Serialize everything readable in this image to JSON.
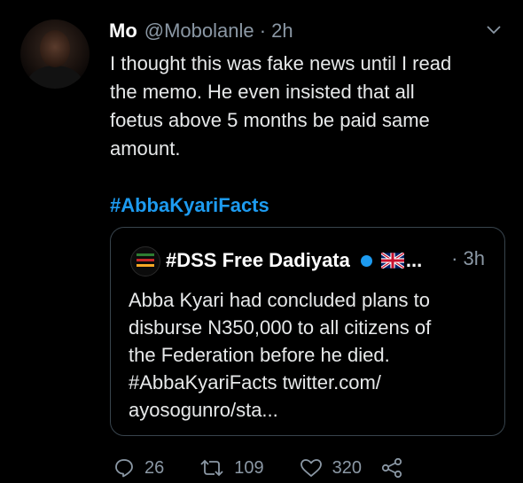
{
  "tweet": {
    "author_name": "Mo",
    "author_handle": "@Mobolanle · 2h",
    "text_lines": [
      "I thought this was fake news until I read",
      "the memo. He even insisted that all",
      "foetus above 5 months be paid same",
      "amount."
    ],
    "hashtag": "#AbbaKyariFacts"
  },
  "quoted": {
    "author_name": "#DSS Free Dadiyata",
    "truncation": "...",
    "time": "· 3h",
    "text_lines": [
      "Abba Kyari had concluded plans to",
      "disburse N350,000 to all citizens of",
      "the Federation before he died.",
      "#AbbaKyariFacts twitter.com/",
      "ayosogunro/sta..."
    ]
  },
  "actions": {
    "reply_count": "26",
    "retweet_count": "109",
    "like_count": "320"
  },
  "icons": [
    "chevron-down-icon",
    "verified-badge-icon",
    "uk-flag-icon",
    "reply-icon",
    "retweet-icon",
    "like-icon",
    "share-icon"
  ],
  "colors": {
    "background": "#000000",
    "link": "#1d9bf0",
    "muted": "#8b98a5",
    "text": "#e7e9ea",
    "border": "#38444d"
  }
}
